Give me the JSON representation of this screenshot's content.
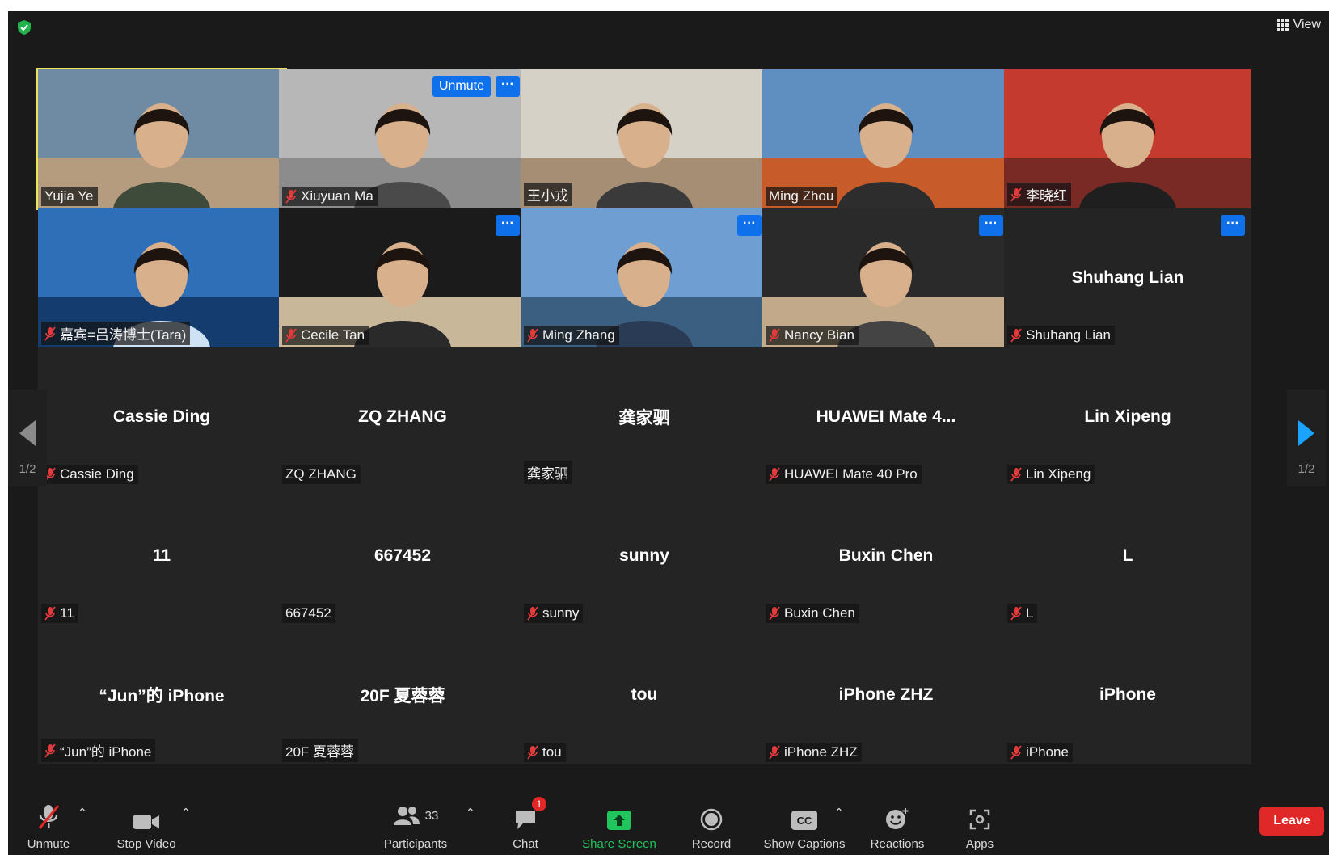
{
  "header": {
    "view_label": "View"
  },
  "pagination": {
    "left_page": "1/2",
    "right_page": "1/2"
  },
  "tiles": [
    {
      "display": "",
      "tag": "Yujia Ye",
      "muted": false,
      "video": true,
      "active": true
    },
    {
      "display": "",
      "tag": "Xiuyuan Ma",
      "muted": true,
      "video": true,
      "unmute": "Unmute",
      "menu": "···"
    },
    {
      "display": "",
      "tag": "王小戎",
      "muted": false,
      "video": true
    },
    {
      "display": "",
      "tag": "Ming Zhou",
      "muted": false,
      "video": true
    },
    {
      "display": "",
      "tag": "李晓红",
      "muted": true,
      "video": true
    },
    {
      "display": "",
      "tag": "嘉宾=吕涛博士(Tara)",
      "muted": true,
      "video": true
    },
    {
      "display": "",
      "tag": "Cecile Tan",
      "muted": true,
      "video": true,
      "menu": "···"
    },
    {
      "display": "",
      "tag": "Ming Zhang",
      "muted": true,
      "video": true,
      "menu": "···"
    },
    {
      "display": "",
      "tag": "Nancy Bian",
      "muted": true,
      "video": true,
      "menu": "···"
    },
    {
      "display": "Shuhang Lian",
      "tag": "Shuhang Lian",
      "muted": true,
      "video": false,
      "menu": "···"
    },
    {
      "display": "Cassie Ding",
      "tag": "Cassie Ding",
      "muted": true,
      "video": false
    },
    {
      "display": "ZQ ZHANG",
      "tag": "ZQ ZHANG",
      "muted": false,
      "video": false
    },
    {
      "display": "龚家驷",
      "tag": "龚家驷",
      "muted": false,
      "video": false
    },
    {
      "display": "HUAWEI Mate 4...",
      "tag": "HUAWEI Mate 40 Pro",
      "muted": true,
      "video": false
    },
    {
      "display": "Lin Xipeng",
      "tag": "Lin Xipeng",
      "muted": true,
      "video": false
    },
    {
      "display": "11",
      "tag": "11",
      "muted": true,
      "video": false
    },
    {
      "display": "667452",
      "tag": "667452",
      "muted": false,
      "video": false
    },
    {
      "display": "sunny",
      "tag": "sunny",
      "muted": true,
      "video": false
    },
    {
      "display": "Buxin Chen",
      "tag": "Buxin Chen",
      "muted": true,
      "video": false
    },
    {
      "display": "L",
      "tag": "L",
      "muted": true,
      "video": false
    },
    {
      "display": "“Jun”的 iPhone",
      "tag": "“Jun”的 iPhone",
      "muted": true,
      "video": false
    },
    {
      "display": "20F 夏蓉蓉",
      "tag": "20F 夏蓉蓉",
      "muted": false,
      "video": false
    },
    {
      "display": "tou",
      "tag": "tou",
      "muted": true,
      "video": false
    },
    {
      "display": "iPhone ZHZ",
      "tag": "iPhone ZHZ",
      "muted": true,
      "video": false
    },
    {
      "display": "iPhone",
      "tag": "iPhone",
      "muted": true,
      "video": false
    }
  ],
  "toolbar": {
    "unmute": "Unmute",
    "stop_video": "Stop Video",
    "participants": "Participants",
    "participant_count": "33",
    "chat": "Chat",
    "chat_badge": "1",
    "share_screen": "Share Screen",
    "record": "Record",
    "show_captions": "Show Captions",
    "reactions": "Reactions",
    "apps": "Apps",
    "leave": "Leave"
  },
  "colors": {
    "accent": "#0e71eb",
    "share_green": "#21c55d",
    "leave_red": "#e02828",
    "active_speaker": "#e7e45a"
  }
}
